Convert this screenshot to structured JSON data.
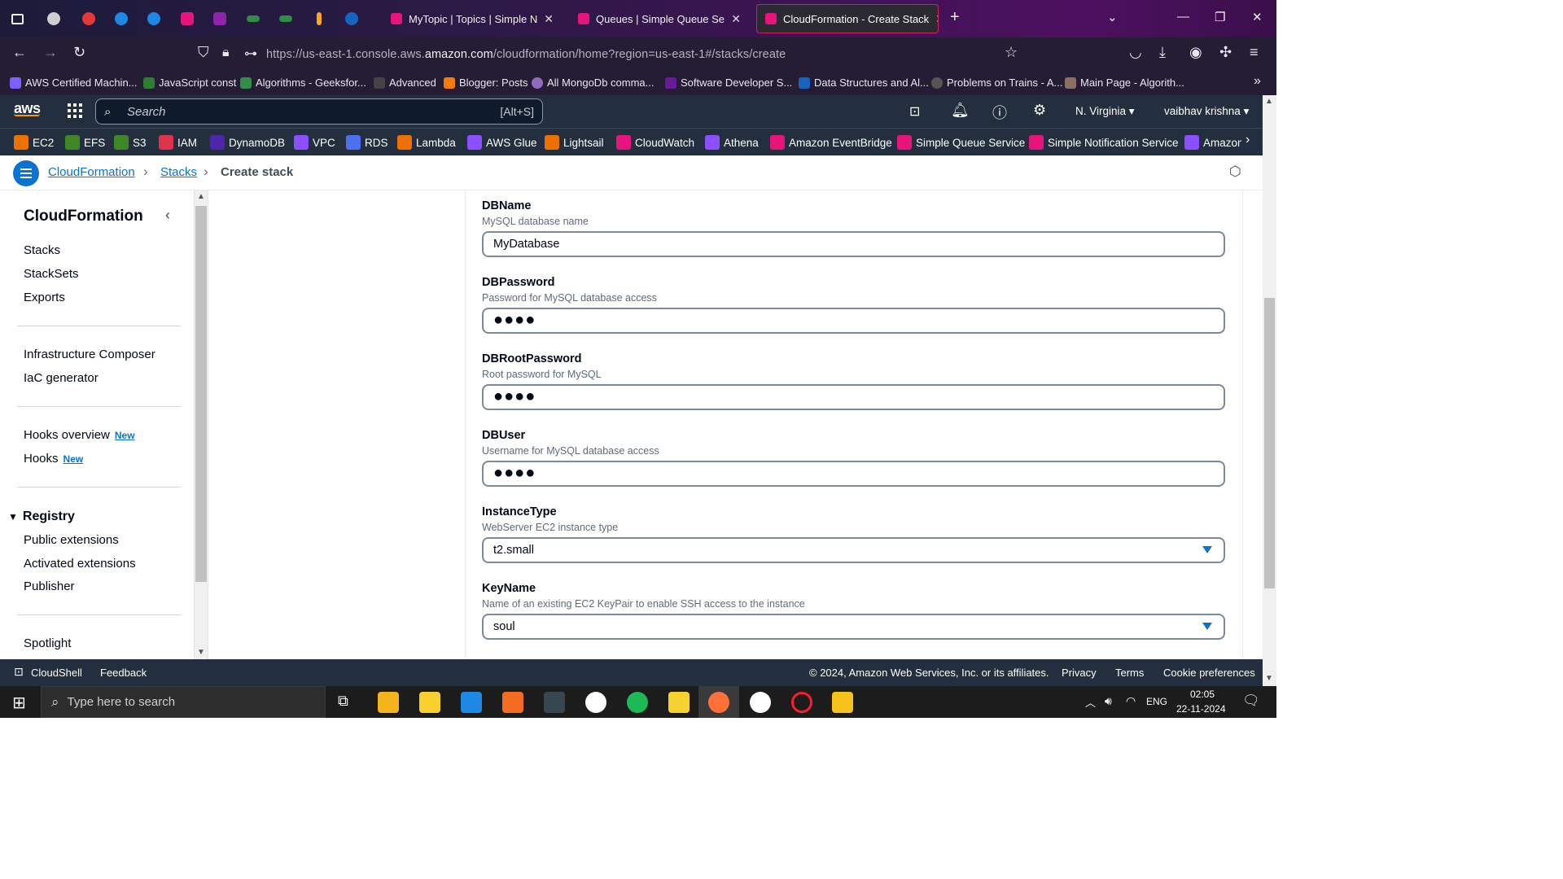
{
  "browser": {
    "tabs": [
      {
        "label": "MyTopic | Topics | Simple Notif",
        "active": false
      },
      {
        "label": "Queues | Simple Queue Service",
        "active": false
      },
      {
        "label": "CloudFormation - Create Stack",
        "active": true
      }
    ],
    "close_glyph": "✕",
    "new_tab_glyph": "+",
    "url_prefix": "https://us-east-1.console.aws.",
    "url_domain": "amazon.com",
    "url_suffix": "/cloudformation/home?region=us-east-1#/stacks/create",
    "bookmarks": [
      {
        "label": "AWS Certified Machin...",
        "color": "#7b61ff"
      },
      {
        "label": "JavaScript const",
        "color": "#2e7d32"
      },
      {
        "label": "Algorithms - Geeksfor...",
        "color": "#2f8d46"
      },
      {
        "label": "Advanced",
        "color": "#444444"
      },
      {
        "label": "Blogger: Posts",
        "color": "#f57c00"
      },
      {
        "label": "All MongoDb comma...",
        "color": "#8e6bbf"
      },
      {
        "label": "Software Developer S...",
        "color": "#6a1b9a"
      },
      {
        "label": "Data Structures and Al...",
        "color": "#1565c0"
      },
      {
        "label": "Problems on Trains - A...",
        "color": "#555555"
      },
      {
        "label": "Main Page - Algorith...",
        "color": "#8d6e63"
      }
    ]
  },
  "aws": {
    "logo": "aws",
    "search_placeholder": "Search",
    "search_shortcut": "[Alt+S]",
    "region": "N. Virginia",
    "user": "vaibhav krishna",
    "services": [
      {
        "label": "EC2",
        "color": "#ed7100"
      },
      {
        "label": "EFS",
        "color": "#3f8624"
      },
      {
        "label": "S3",
        "color": "#3f8624"
      },
      {
        "label": "IAM",
        "color": "#dd344c"
      },
      {
        "label": "DynamoDB",
        "color": "#4d27aa"
      },
      {
        "label": "VPC",
        "color": "#8c4fff"
      },
      {
        "label": "RDS",
        "color": "#4d6ff0"
      },
      {
        "label": "Lambda",
        "color": "#ed7100"
      },
      {
        "label": "AWS Glue",
        "color": "#8c4fff"
      },
      {
        "label": "Lightsail",
        "color": "#ed7100"
      },
      {
        "label": "CloudWatch",
        "color": "#e7157b"
      },
      {
        "label": "Athena",
        "color": "#8c4fff"
      },
      {
        "label": "Amazon EventBridge",
        "color": "#e7157b"
      },
      {
        "label": "Simple Queue Service",
        "color": "#e7157b"
      },
      {
        "label": "Simple Notification Service",
        "color": "#e7157b"
      },
      {
        "label": "Amazon",
        "color": "#8c4fff"
      }
    ]
  },
  "breadcrumb": {
    "items": [
      "CloudFormation",
      "Stacks",
      "Create stack"
    ],
    "separator": "›"
  },
  "sidebar": {
    "title": "CloudFormation",
    "group1": [
      "Stacks",
      "StackSets",
      "Exports"
    ],
    "group2": [
      "Infrastructure Composer",
      "IaC generator"
    ],
    "hooks_overview": "Hooks overview",
    "hooks": "Hooks",
    "new_badge": "New",
    "registry_title": "Registry",
    "registry_items": [
      "Public extensions",
      "Activated extensions",
      "Publisher"
    ],
    "spotlight": "Spotlight"
  },
  "parameters": [
    {
      "name": "DBName",
      "description": "MySQL database name",
      "value": "MyDatabase",
      "kind": "text"
    },
    {
      "name": "DBPassword",
      "description": "Password for MySQL database access",
      "value": "●●●●",
      "kind": "password"
    },
    {
      "name": "DBRootPassword",
      "description": "Root password for MySQL",
      "value": "●●●●",
      "kind": "password"
    },
    {
      "name": "DBUser",
      "description": "Username for MySQL database access",
      "value": "●●●●",
      "kind": "password"
    },
    {
      "name": "InstanceType",
      "description": "WebServer EC2 instance type",
      "value": "t2.small",
      "kind": "select"
    },
    {
      "name": "KeyName",
      "description": "Name of an existing EC2 KeyPair to enable SSH access to the instance",
      "value": "soul",
      "kind": "select"
    }
  ],
  "footer": {
    "cloudshell": "CloudShell",
    "feedback": "Feedback",
    "copyright": "© 2024, Amazon Web Services, Inc. or its affiliates.",
    "links": [
      "Privacy",
      "Terms",
      "Cookie preferences"
    ]
  },
  "taskbar": {
    "search_placeholder": "Type here to search",
    "language": "ENG",
    "time": "02:05",
    "date": "22-11-2024"
  }
}
